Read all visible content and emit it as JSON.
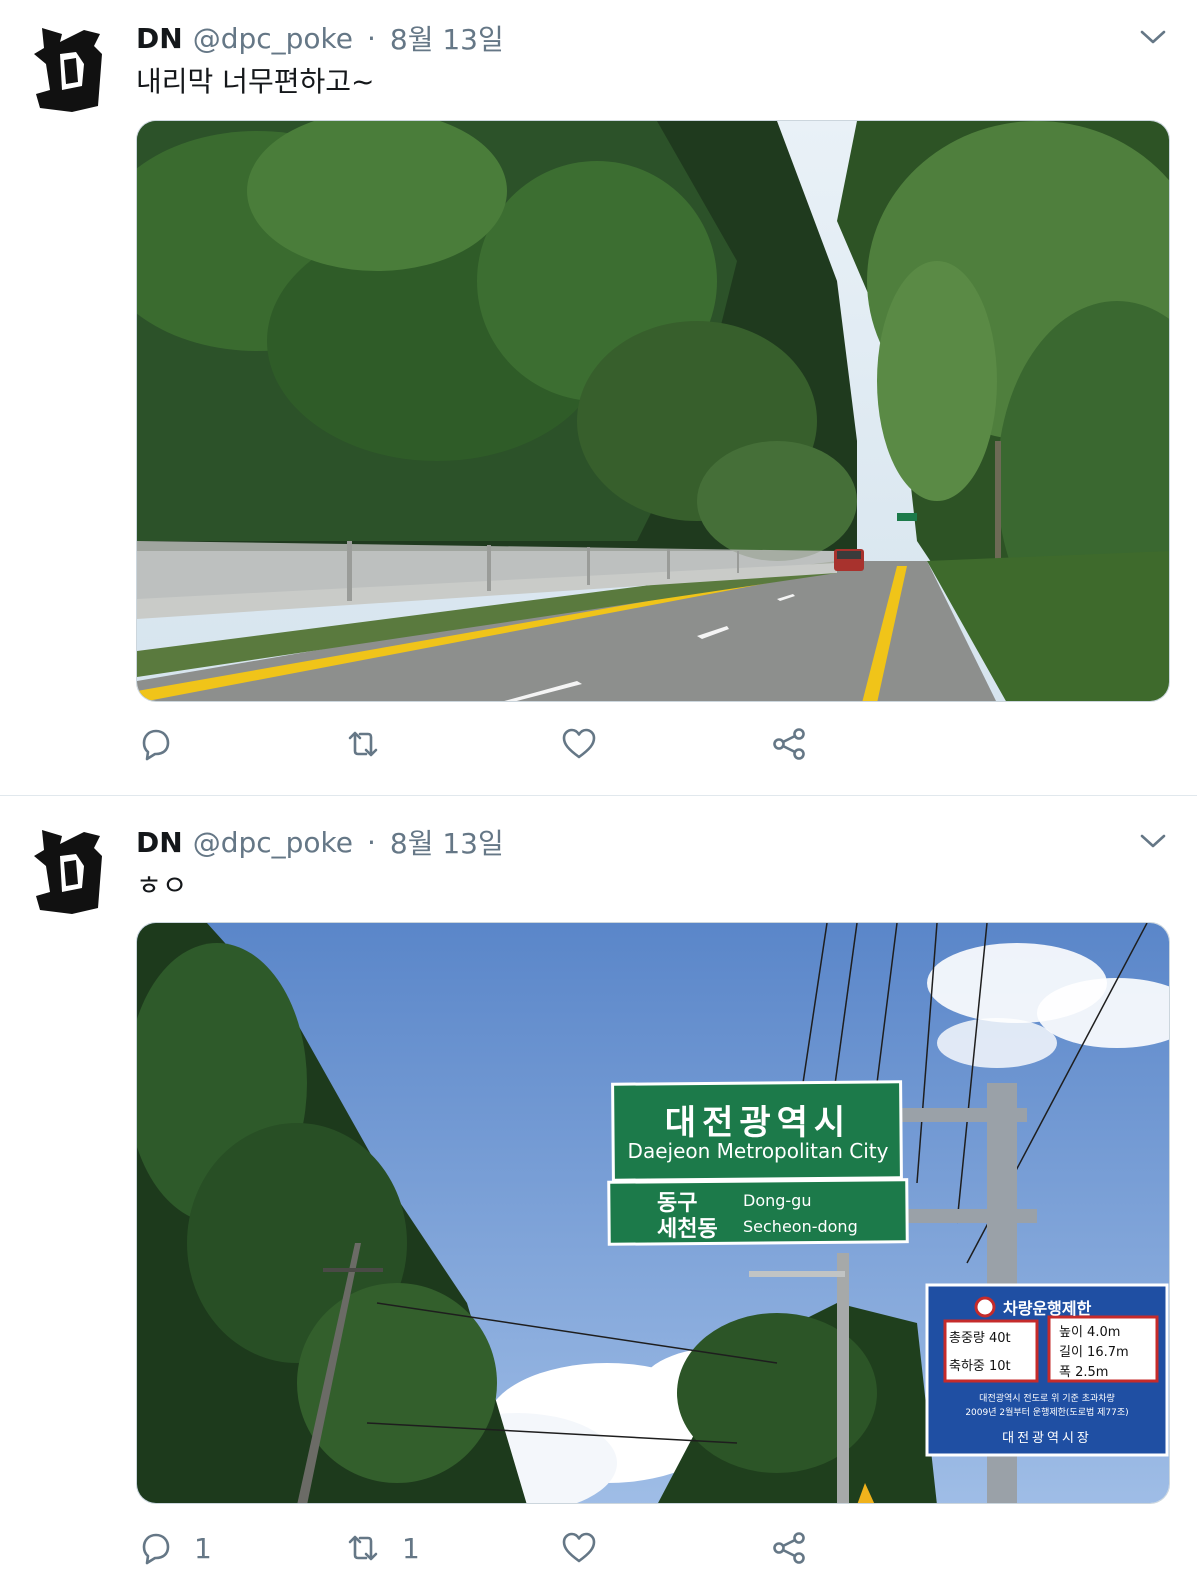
{
  "tweets": [
    {
      "display_name": "DN",
      "handle": "@dpc_poke",
      "separator": "·",
      "date": "8월 13일",
      "text": "내리막 너무편하고~",
      "actions": {
        "reply_count": "",
        "retweet_count": "",
        "like_count": ""
      },
      "media": {
        "icon": "photo-forest-road"
      }
    },
    {
      "display_name": "DN",
      "handle": "@dpc_poke",
      "separator": "·",
      "date": "8월 13일",
      "text": "ㅎㅇ",
      "actions": {
        "reply_count": "1",
        "retweet_count": "1",
        "like_count": ""
      },
      "media": {
        "icon": "photo-city-sign",
        "sign": {
          "title_ko": "대전광역시",
          "title_en": "Daejeon Metropolitan City",
          "district_ko": "동구",
          "district_en": "Dong-gu",
          "town_ko": "세천동",
          "town_en": "Secheon-dong"
        },
        "restriction": {
          "title": "차량운행제한",
          "weight_total": "총중량 40t",
          "weight_axle": "축하중 10t",
          "height": "높이 4.0m",
          "length": "길이 16.7m",
          "width": "폭 2.5m",
          "note1": "대전광역시 전도로 위 기준 초과차량",
          "note2": "2009년 2월부터 운행제한(도로법 제77조)",
          "issuer": "대전광역시장"
        }
      }
    }
  ],
  "colors": {
    "text": "#14171a",
    "muted": "#657786",
    "border": "#e1e8ed",
    "sign_green": "#1c7a4a",
    "sign_blue": "#1f4fa3"
  },
  "icons": [
    "avatar-logo",
    "chevron-down-icon",
    "reply-icon",
    "retweet-icon",
    "like-icon",
    "share-icon"
  ]
}
